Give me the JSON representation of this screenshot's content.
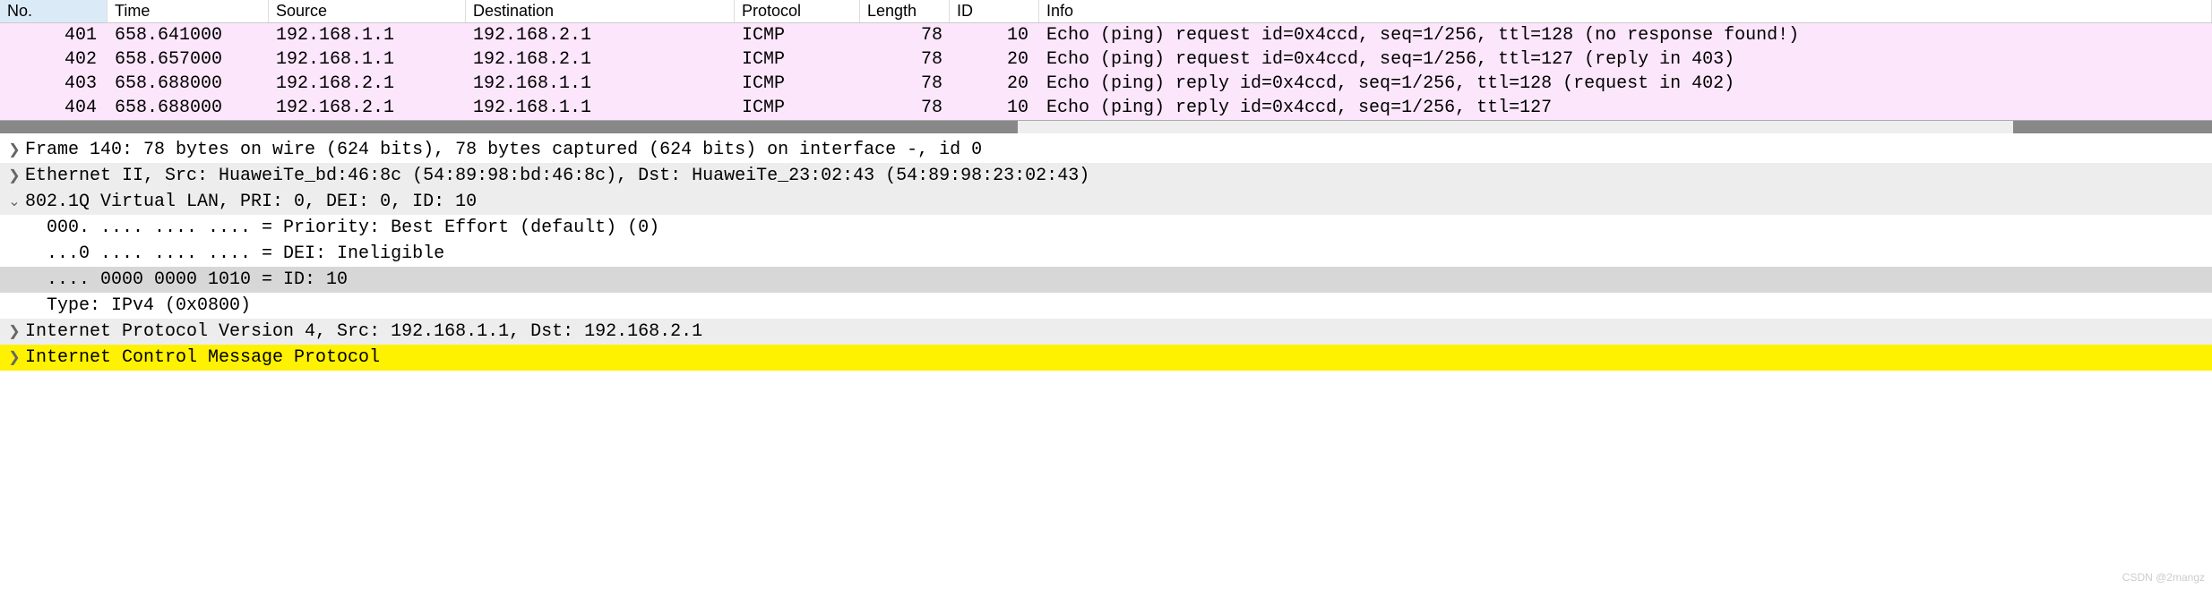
{
  "columns": {
    "no": "No.",
    "time": "Time",
    "source": "Source",
    "dest": "Destination",
    "proto": "Protocol",
    "length": "Length",
    "id": "ID",
    "info": "Info"
  },
  "packets": [
    {
      "no": "401",
      "time": "658.641000",
      "source": "192.168.1.1",
      "dest": "192.168.2.1",
      "proto": "ICMP",
      "length": "78",
      "id": "10",
      "info": "Echo (ping) request  id=0x4ccd, seq=1/256, ttl=128 (no response found!)"
    },
    {
      "no": "402",
      "time": "658.657000",
      "source": "192.168.1.1",
      "dest": "192.168.2.1",
      "proto": "ICMP",
      "length": "78",
      "id": "20",
      "info": "Echo (ping) request  id=0x4ccd, seq=1/256, ttl=127 (reply in 403)"
    },
    {
      "no": "403",
      "time": "658.688000",
      "source": "192.168.2.1",
      "dest": "192.168.1.1",
      "proto": "ICMP",
      "length": "78",
      "id": "20",
      "info": "Echo (ping) reply    id=0x4ccd, seq=1/256, ttl=128 (request in 402)"
    },
    {
      "no": "404",
      "time": "658.688000",
      "source": "192.168.2.1",
      "dest": "192.168.1.1",
      "proto": "ICMP",
      "length": "78",
      "id": "10",
      "info": "Echo (ping) reply    id=0x4ccd, seq=1/256, ttl=127"
    }
  ],
  "details": {
    "frame": "Frame 140: 78 bytes on wire (624 bits), 78 bytes captured (624 bits) on interface -, id 0",
    "ethernet": "Ethernet II, Src: HuaweiTe_bd:46:8c (54:89:98:bd:46:8c), Dst: HuaweiTe_23:02:43 (54:89:98:23:02:43)",
    "vlan": "802.1Q Virtual LAN, PRI: 0, DEI: 0, ID: 10",
    "vlan_priority": "000. .... .... .... = Priority: Best Effort (default) (0)",
    "vlan_dei": "...0 .... .... .... = DEI: Ineligible",
    "vlan_id": ".... 0000 0000 1010 = ID: 10",
    "vlan_type": "Type: IPv4 (0x0800)",
    "ipv4": "Internet Protocol Version 4, Src: 192.168.1.1, Dst: 192.168.2.1",
    "icmp": "Internet Control Message Protocol"
  },
  "icons": {
    "collapsed": "❯",
    "expanded": "⌄"
  },
  "watermark": "CSDN @2mangz"
}
